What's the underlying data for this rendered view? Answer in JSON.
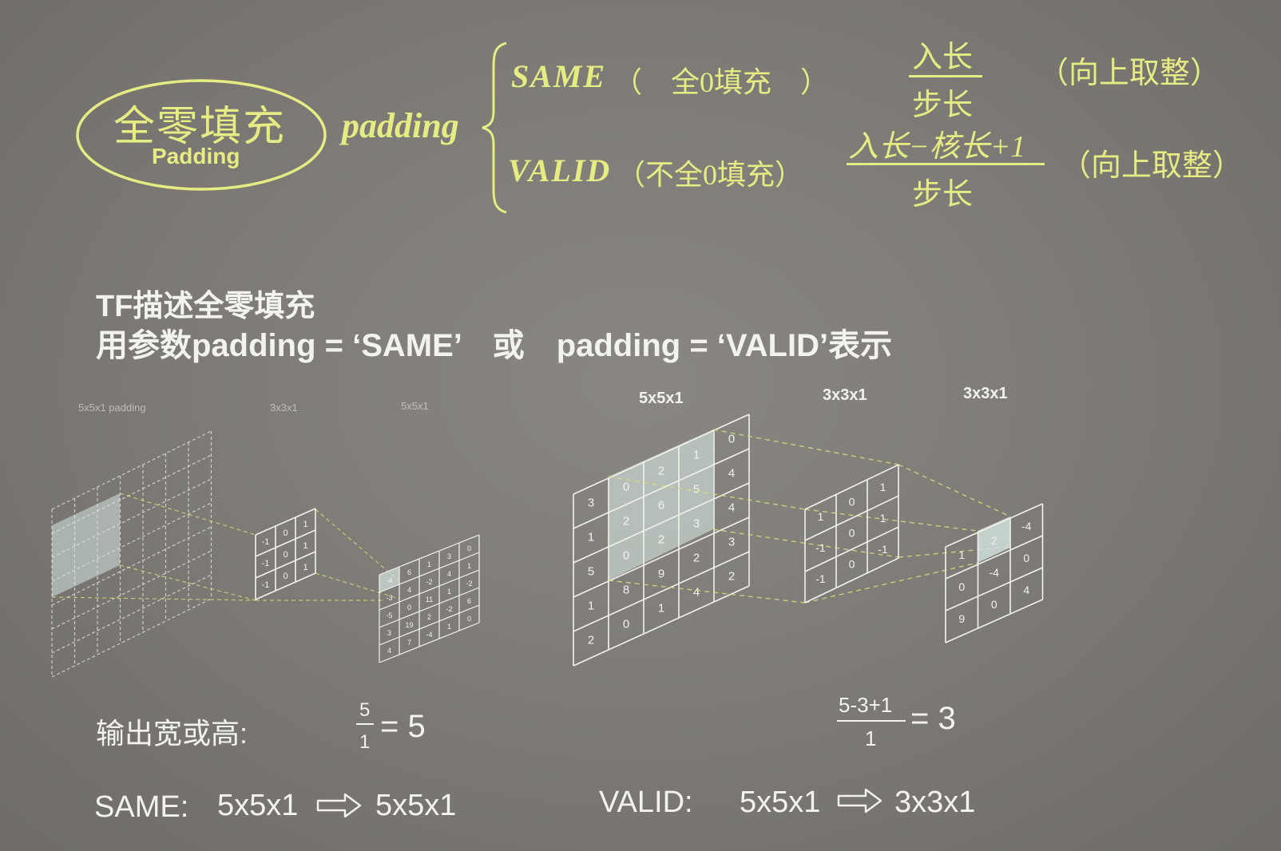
{
  "header": {
    "oval_title": "全零填充",
    "oval_subtitle": "Padding",
    "padding_label": "padding",
    "same_label": "SAME",
    "same_paren": "（　全0填充　）",
    "valid_label": "VALID",
    "valid_paren": "（不全0填充）",
    "same_numerator": "入长",
    "same_denominator": "步长",
    "same_note": "（向上取整）",
    "valid_numerator": "入长−核长+1",
    "valid_denominator": "步长",
    "valid_note": "（向上取整）"
  },
  "tf": {
    "line1": "TF描述全零填充",
    "line2": "用参数padding = ‘SAME’　或　padding = ‘VALID’表示"
  },
  "left_diagram": {
    "label_input": "5x5x1 padding",
    "label_kernel": "3x3x1",
    "label_output": "5x5x1",
    "kernel_values": [
      "-1",
      "0",
      "1",
      "-1",
      "0",
      "1",
      "-1",
      "0",
      "1"
    ],
    "output_values": [
      "-4",
      "6",
      "1",
      "3",
      "0",
      "-3",
      "4",
      "-2",
      "4",
      "1",
      "-5",
      "0",
      "11",
      "1",
      "-2",
      "3",
      "19",
      "2",
      "-2",
      "6",
      "4",
      "7",
      "-4",
      "1",
      "0"
    ]
  },
  "right_diagram": {
    "label_input": "5x5x1",
    "label_kernel": "3x3x1",
    "label_output": "3x3x1",
    "input_values": [
      "3",
      "0",
      "2",
      "1",
      "0",
      "1",
      "2",
      "6",
      "5",
      "4",
      "5",
      "0",
      "2",
      "3",
      "4",
      "1",
      "8",
      "9",
      "2",
      "3",
      "2",
      "0",
      "1",
      "4",
      "2"
    ],
    "kernel_values": [
      "1",
      "0",
      "1",
      "-1",
      "0",
      "1",
      "-1",
      "0",
      "-1"
    ],
    "output_values": [
      "1",
      "2",
      "-4",
      "0",
      "-4",
      "0",
      "9",
      "0",
      "4"
    ]
  },
  "formulas": {
    "output_label": "输出宽或高:",
    "same_num": "5",
    "same_den": "1",
    "same_result": "= 5",
    "valid_num": "5-3+1",
    "valid_den": "1",
    "valid_result": "= 3"
  },
  "summary": {
    "same_label": "SAME:",
    "same_in": "5x5x1",
    "same_out": "5x5x1",
    "valid_label": "VALID:",
    "valid_in": "5x5x1",
    "valid_out": "3x3x1",
    "arrow_icon": "right-arrow-icon"
  },
  "colors": {
    "accent_yellow": "#e6ec84",
    "text_white": "#f2f2ee",
    "highlight_cell": "#cfe3dc"
  }
}
